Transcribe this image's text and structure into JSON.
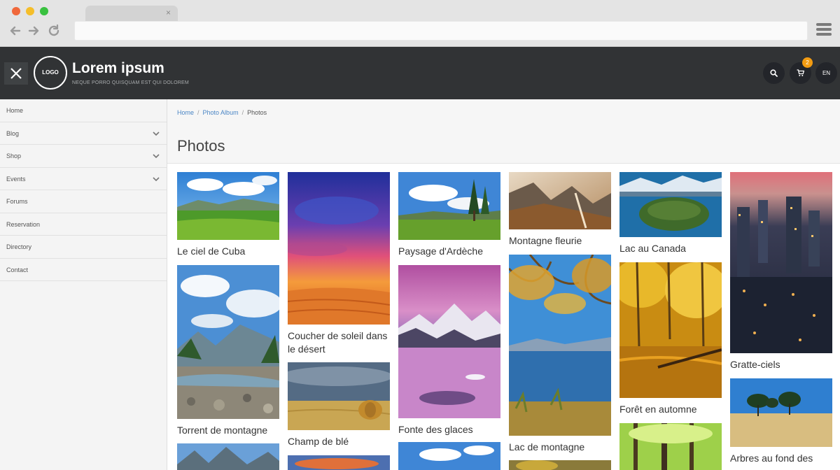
{
  "browser": {
    "tab_close": "×"
  },
  "header": {
    "logo_text": "LOGO",
    "site_title": "Lorem ipsum",
    "tagline": "NEQUE PORRO QUISQUAM EST QUI DOLOREM",
    "cart_count": "2",
    "language": "EN"
  },
  "sidebar": {
    "items": [
      {
        "label": "Home",
        "has_children": false
      },
      {
        "label": "Blog",
        "has_children": true
      },
      {
        "label": "Shop",
        "has_children": true
      },
      {
        "label": "Events",
        "has_children": true
      },
      {
        "label": "Forums",
        "has_children": false
      },
      {
        "label": "Reservation",
        "has_children": false
      },
      {
        "label": "Directory",
        "has_children": false
      },
      {
        "label": "Contact",
        "has_children": false
      }
    ]
  },
  "breadcrumb": [
    "Home",
    "Photo Album",
    "Photos"
  ],
  "page_title": "Photos",
  "photos": {
    "cuba": "Le ciel de Cuba",
    "torrent": "Torrent de montagne",
    "desert": "Coucher de soleil dans le désert",
    "ble": "Champ de blé",
    "ardeche": "Paysage d'Ardèche",
    "glaces": "Fonte des glaces",
    "fleurie": "Montagne fleurie",
    "lac_montagne": "Lac de montagne",
    "canada": "Lac au Canada",
    "automne": "Forêt en automne",
    "gratte": "Gratte-ciels",
    "arbres": "Arbres au fond des"
  },
  "colors": {
    "header_bg": "#313335",
    "link": "#4a86c5",
    "badge": "#f39c12"
  }
}
